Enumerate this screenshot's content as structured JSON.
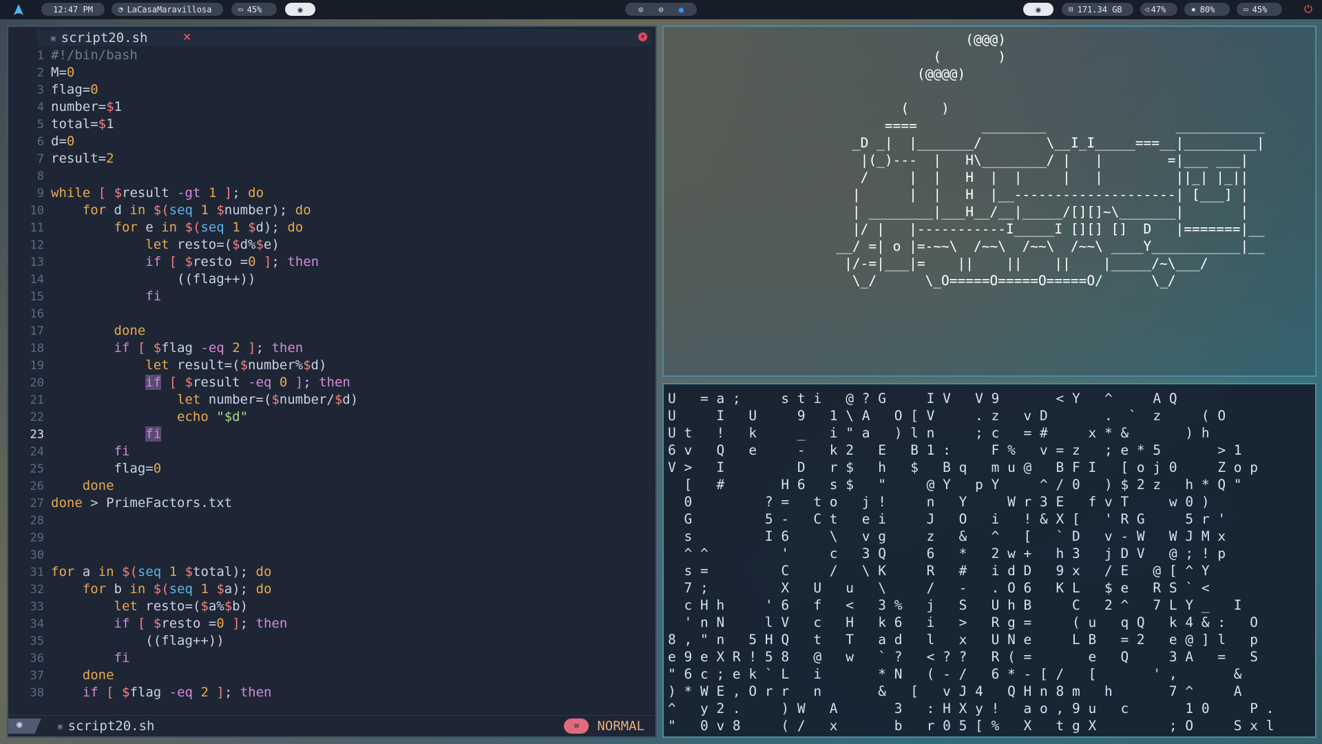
{
  "topbar": {
    "time": "12:47 PM",
    "wifi": "LaCasaMaravillosa",
    "battery_left": "45%",
    "disk": "171.34 GB",
    "volume": "47%",
    "brightness": "80%",
    "battery_right": "45%",
    "icons": {
      "logo": "arch-logo-icon",
      "wifi": "wifi-icon",
      "battery": "battery-icon",
      "ghost": "ghost-icon",
      "workspaces": [
        "workspace-1-icon",
        "workspace-2-icon",
        "workspace-3-active-icon"
      ],
      "disk": "disk-icon",
      "volume": "volume-icon",
      "brightness": "brightness-icon",
      "power": "power-icon"
    }
  },
  "editor": {
    "tab_title": "script20.sh",
    "tab_close": "✕",
    "status_file": "script20.sh",
    "mode": "NORMAL",
    "current_line": 23,
    "colors": {
      "accent": "#e06c7a",
      "keyword": "#e8a94f",
      "control": "#d38ad8"
    }
  },
  "code_lines": [
    "#!/bin/bash",
    "M=0",
    "flag=0",
    "number=$1",
    "total=$1",
    "d=0",
    "result=2",
    "",
    "while [ $result -gt 1 ]; do",
    "    for d in $(seq 1 $number); do",
    "        for e in $(seq 1 $d); do",
    "            let resto=($d%$e)",
    "            if [ $resto = 0 ]; then",
    "                ((flag++))",
    "            fi",
    "",
    "        done",
    "        if [ $flag -eq 2 ]; then",
    "            let result=($number%$d)",
    "            if [ $result -eq 0 ]; then",
    "                let number=($number/$d)",
    "                echo \"$d\"",
    "            fi",
    "        fi",
    "        flag=0",
    "    done",
    "done > PrimeFactors.txt",
    "",
    "",
    "",
    "for a in $(seq 1 $total); do",
    "    for b in $(seq 1 $a); do",
    "        let resto=($a%$b)",
    "        if [ $resto = 0 ]; then",
    "            ((flag++))",
    "        fi",
    "    done",
    "    if [ $flag -eq 2 ]; then"
  ],
  "train_art": [
    "                      (@@@)",
    "                  (       )",
    "                (@@@@)",
    "",
    "              (    )",
    "            ====        ________                ___________",
    "        _D _|  |_______/        \\__I_I_____===__|_________|",
    "         |(_)---  |   H\\________/ |   |        =|___ ___|",
    "         /     |  |   H  |  |     |   |         ||_| |_||",
    "        |      |  |   H  |__--------------------| [___] |",
    "        | ________|___H__/__|_____/[][]~\\_______|       |",
    "        |/ |   |-----------I_____I [][] []  D   |=======|__",
    "      __/ =| o |=-~~\\  /~~\\  /~~\\  /~~\\ ____Y___________|__",
    "       |/-=|___|=    ||    ||    ||    |_____/~\\___/",
    "        \\_/      \\_O=====O=====O=====O/      \\_/"
  ],
  "matrix_lines": [
    "U   = a ;     s t i   @ ? G     I V   V 9       < Y   ^     A Q",
    "U     I   U     9   1 \\ A   O [ V     . z   v D       .  `  z     ( O",
    "U t   !   k     _   i \" a   ) l n     ; c   = #     x * &       ) h",
    "6 v   Q   e     -   k 2   E   B 1 :     F %   v = z   ; e * 5       > 1",
    "V >   I         D   r $   h   $   B q   m u @   B F I   [ o j 0     Z o p",
    "  [   #       H 6   s $   \"     @ Y   p Y     ^ / 0   ) $ 2 z   h * Q \"",
    "  0         ? =   t o   j !     n   Y     W r 3 E   f v T     w 0 )",
    "  G         5 -   C t   e i     J   O   i   ! & X [   ' R G     5 r '",
    "  s         I 6     \\   v g     z   &   ^   [   ` D   v - W   W J M x",
    "  ^ ^         '     c   3 Q     6   *   2 w +   h 3   j D V   @ ; ! p",
    "  s =         C     /   \\ K     R   #   i d D   9 x   / E   @ [ ^ Y",
    "  7 ;         X   U   u   \\     /   -   . O 6   K L   $ e   R S ` <",
    "  c H h     ' 6   f   <   3 %   j   S   U h B     C   2 ^   7 L Y _   I",
    "  ' n N     l V   c   H   k 6   i   >   R g =     ( u   q Q   k 4 & :   O",
    "8 , \" n   5 H Q   t   T   a d   l   x   U N e     L B   = 2   e @ ] l   p",
    "e 9 e X R ! 5 8   @   w   ` ?   < ? ?   R ( =       e   Q     3 A   =   S",
    "\" 6 c ; e k ` L   i       * N   ( - /   6 * - [ /   [       ' ,       &",
    ") * W E , O r r   n       &   [   v J 4   Q H n 8 m   h       7 ^     A",
    "^   y 2 .     ) W   A       3   : H X y !   a o , 9 u   c       1 0     P .",
    "\"   0 v 8     ( /   x       b   r 0 5 [ %   X   t g X         ; O     S x l"
  ]
}
